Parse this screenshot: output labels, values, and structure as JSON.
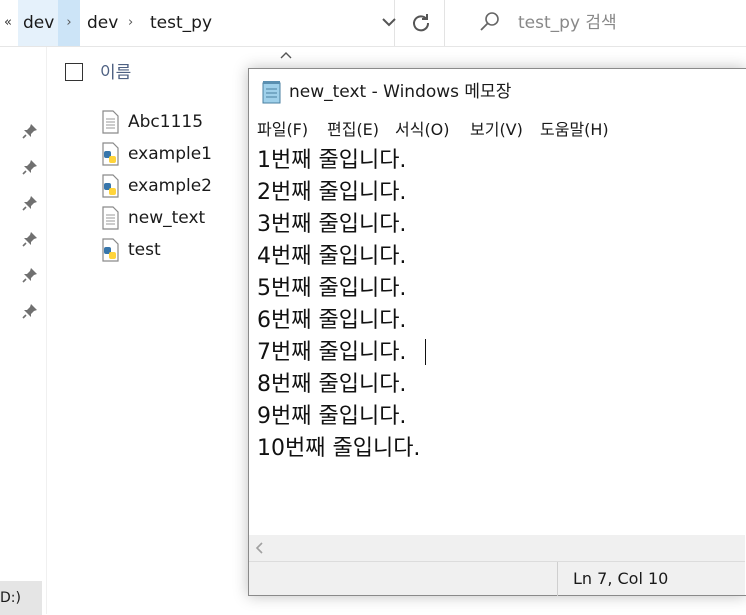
{
  "explorer": {
    "overflow_glyph": "«",
    "breadcrumbs": [
      "dev",
      "dev",
      "test_py"
    ],
    "search_placeholder": "test_py 검색",
    "column_name": "이름",
    "drive_label": "D:)",
    "files": [
      {
        "name": "Abc1115",
        "icon": "text-file-icon"
      },
      {
        "name": "example1",
        "icon": "python-file-icon"
      },
      {
        "name": "example2",
        "icon": "python-file-icon"
      },
      {
        "name": "new_text",
        "icon": "text-file-icon"
      },
      {
        "name": "test",
        "icon": "python-file-icon"
      }
    ]
  },
  "notepad": {
    "title": "new_text - Windows 메모장",
    "menu": [
      "파일(F)",
      "편집(E)",
      "서식(O)",
      "보기(V)",
      "도움말(H)"
    ],
    "lines": [
      "1번째 줄입니다.",
      "2번째 줄입니다.",
      "3번째 줄입니다.",
      "4번째 줄입니다.",
      "5번째 줄입니다.",
      "6번째 줄입니다.",
      "7번째 줄입니다.",
      "8번째 줄입니다.",
      "9번째 줄입니다.",
      "10번째 줄입니다."
    ],
    "status": "Ln 7, Col 10"
  },
  "colors": {
    "selection_bg": "#e5f1fb",
    "header_text": "#4d6082",
    "status_bg": "#f0f0f0"
  }
}
